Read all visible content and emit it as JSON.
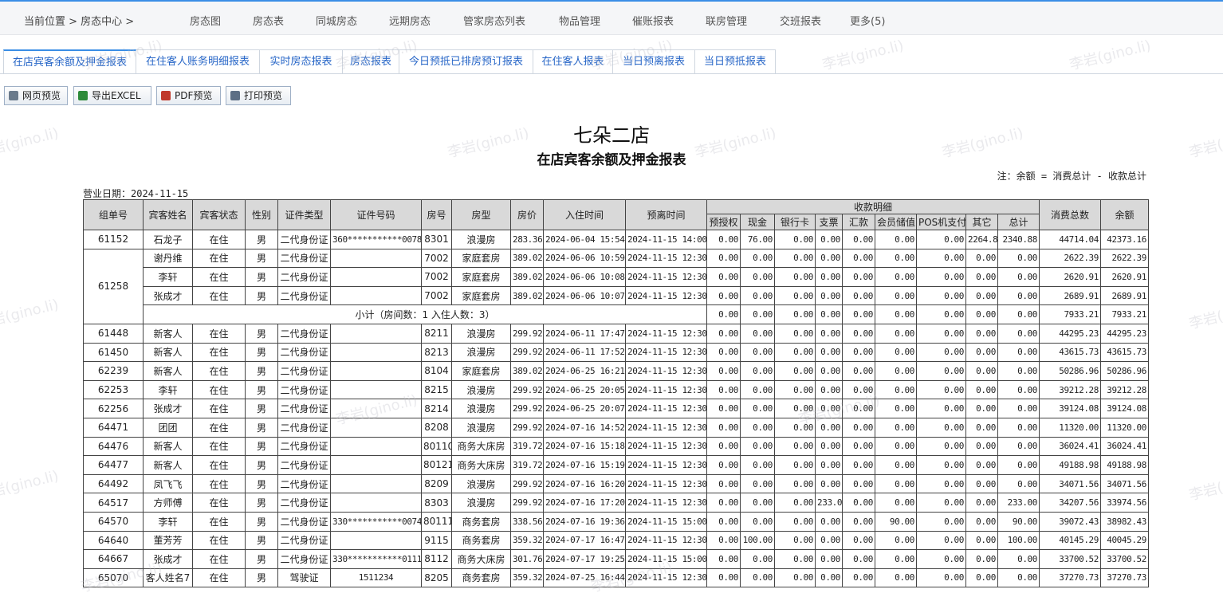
{
  "breadcrumb": {
    "label": "当前位置 > 房态中心 >"
  },
  "top_nav": [
    "房态图",
    "房态表",
    "同城房态",
    "远期房态",
    "管家房态列表",
    "物品管理",
    "催账报表",
    "联房管理",
    "交班报表",
    "更多(5)"
  ],
  "tabs": [
    "在店宾客余额及押金报表",
    "在住客人账务明细报表",
    "实时房态报表",
    "房态报表",
    "今日预抵已排房预订报表",
    "在住客人报表",
    "当日预离报表",
    "当日预抵报表"
  ],
  "active_tab": 0,
  "toolbar": {
    "web_preview": "网页预览",
    "export_excel": "导出EXCEL",
    "pdf_preview": "PDF预览",
    "print_preview": "打印预览"
  },
  "report": {
    "hotel": "七朵二店",
    "title": "在店宾客余额及押金报表",
    "note": "注：余额 = 消费总计 - 收款总计",
    "business_date": "营业日期：2024-11-15",
    "headers": {
      "group_no": "组单号",
      "guest": "宾客姓名",
      "status": "宾客状态",
      "gender": "性别",
      "id_type": "证件类型",
      "id_no": "证件号码",
      "room_no": "房号",
      "room_type": "房型",
      "price": "房价",
      "checkin": "入住时间",
      "checkout": "预离时间",
      "payment_detail": "收款明细",
      "consume_total": "消费总数",
      "balance": "余额",
      "payment_cols": [
        "预授权",
        "现金",
        "银行卡",
        "支票",
        "汇款",
        "会员储值",
        "POS机支付",
        "其它",
        "总计"
      ]
    },
    "rows": [
      {
        "group": "61152",
        "name": "石龙子",
        "status": "在住",
        "gender": "男",
        "idtype": "二代身份证",
        "idno": "360***********0078",
        "room": "8301",
        "rtype": "浪漫房",
        "price": "283.36",
        "in": "2024-06-04 15:54",
        "out": "2024-11-15 14:00",
        "p": [
          "0.00",
          "76.00",
          "0.00",
          "0.00",
          "0.00",
          "0.00",
          "0.00",
          "2264.8",
          "2340.88"
        ],
        "consume": "44714.04",
        "balance": "42373.16"
      },
      {
        "group": "61258",
        "name": "谢丹维",
        "status": "在住",
        "gender": "男",
        "idtype": "二代身份证",
        "idno": "",
        "room": "7002",
        "rtype": "家庭套房",
        "price": "389.02",
        "in": "2024-06-06 10:59",
        "out": "2024-11-15 12:30",
        "p": [
          "0.00",
          "0.00",
          "0.00",
          "0.00",
          "0.00",
          "0.00",
          "0.00",
          "0.00",
          "0.00"
        ],
        "consume": "2622.39",
        "balance": "2622.39"
      },
      {
        "group": "",
        "name": "李轩",
        "status": "在住",
        "gender": "男",
        "idtype": "二代身份证",
        "idno": "",
        "room": "7002",
        "rtype": "家庭套房",
        "price": "389.02",
        "in": "2024-06-06 10:08",
        "out": "2024-11-15 12:30",
        "p": [
          "0.00",
          "0.00",
          "0.00",
          "0.00",
          "0.00",
          "0.00",
          "0.00",
          "0.00",
          "0.00"
        ],
        "consume": "2620.91",
        "balance": "2620.91"
      },
      {
        "group": "",
        "name": "张成才",
        "status": "在住",
        "gender": "男",
        "idtype": "二代身份证",
        "idno": "",
        "room": "7002",
        "rtype": "家庭套房",
        "price": "389.02",
        "in": "2024-06-06 10:07",
        "out": "2024-11-15 12:30",
        "p": [
          "0.00",
          "0.00",
          "0.00",
          "0.00",
          "0.00",
          "0.00",
          "0.00",
          "0.00",
          "0.00"
        ],
        "consume": "2689.91",
        "balance": "2689.91"
      },
      {
        "subtotal": true,
        "label": "小计（房间数：1   入住人数：3）",
        "p": [
          "0.00",
          "0.00",
          "0.00",
          "0.00",
          "0.00",
          "0.00",
          "0.00",
          "0.00",
          "0.00"
        ],
        "consume": "7933.21",
        "balance": "7933.21"
      },
      {
        "group": "61448",
        "name": "新客人",
        "status": "在住",
        "gender": "男",
        "idtype": "二代身份证",
        "idno": "",
        "room": "8211",
        "rtype": "浪漫房",
        "price": "299.92",
        "in": "2024-06-11 17:47",
        "out": "2024-11-15 12:30",
        "p": [
          "0.00",
          "0.00",
          "0.00",
          "0.00",
          "0.00",
          "0.00",
          "0.00",
          "0.00",
          "0.00"
        ],
        "consume": "44295.23",
        "balance": "44295.23"
      },
      {
        "group": "61450",
        "name": "新客人",
        "status": "在住",
        "gender": "男",
        "idtype": "二代身份证",
        "idno": "",
        "room": "8213",
        "rtype": "浪漫房",
        "price": "299.92",
        "in": "2024-06-11 17:52",
        "out": "2024-11-15 12:30",
        "p": [
          "0.00",
          "0.00",
          "0.00",
          "0.00",
          "0.00",
          "0.00",
          "0.00",
          "0.00",
          "0.00"
        ],
        "consume": "43615.73",
        "balance": "43615.73"
      },
      {
        "group": "62239",
        "name": "新客人",
        "status": "在住",
        "gender": "男",
        "idtype": "二代身份证",
        "idno": "",
        "room": "8104",
        "rtype": "家庭套房",
        "price": "389.02",
        "in": "2024-06-25 16:21",
        "out": "2024-11-15 12:30",
        "p": [
          "0.00",
          "0.00",
          "0.00",
          "0.00",
          "0.00",
          "0.00",
          "0.00",
          "0.00",
          "0.00"
        ],
        "consume": "50286.96",
        "balance": "50286.96"
      },
      {
        "group": "62253",
        "name": "李轩",
        "status": "在住",
        "gender": "男",
        "idtype": "二代身份证",
        "idno": "",
        "room": "8215",
        "rtype": "浪漫房",
        "price": "299.92",
        "in": "2024-06-25 20:05",
        "out": "2024-11-15 12:30",
        "p": [
          "0.00",
          "0.00",
          "0.00",
          "0.00",
          "0.00",
          "0.00",
          "0.00",
          "0.00",
          "0.00"
        ],
        "consume": "39212.28",
        "balance": "39212.28"
      },
      {
        "group": "62256",
        "name": "张成才",
        "status": "在住",
        "gender": "男",
        "idtype": "二代身份证",
        "idno": "",
        "room": "8214",
        "rtype": "浪漫房",
        "price": "299.92",
        "in": "2024-06-25 20:07",
        "out": "2024-11-15 12:30",
        "p": [
          "0.00",
          "0.00",
          "0.00",
          "0.00",
          "0.00",
          "0.00",
          "0.00",
          "0.00",
          "0.00"
        ],
        "consume": "39124.08",
        "balance": "39124.08"
      },
      {
        "group": "64471",
        "name": "团团",
        "status": "在住",
        "gender": "男",
        "idtype": "二代身份证",
        "idno": "",
        "room": "8208",
        "rtype": "浪漫房",
        "price": "299.92",
        "in": "2024-07-16 14:52",
        "out": "2024-11-15 12:30",
        "p": [
          "0.00",
          "0.00",
          "0.00",
          "0.00",
          "0.00",
          "0.00",
          "0.00",
          "0.00",
          "0.00"
        ],
        "consume": "11320.00",
        "balance": "11320.00"
      },
      {
        "group": "64476",
        "name": "新客人",
        "status": "在住",
        "gender": "男",
        "idtype": "二代身份证",
        "idno": "",
        "room": "80110",
        "rtype": "商务大床房",
        "price": "319.72",
        "in": "2024-07-16 15:18",
        "out": "2024-11-15 12:30",
        "p": [
          "0.00",
          "0.00",
          "0.00",
          "0.00",
          "0.00",
          "0.00",
          "0.00",
          "0.00",
          "0.00"
        ],
        "consume": "36024.41",
        "balance": "36024.41"
      },
      {
        "group": "64477",
        "name": "新客人",
        "status": "在住",
        "gender": "男",
        "idtype": "二代身份证",
        "idno": "",
        "room": "80121",
        "rtype": "商务大床房",
        "price": "319.72",
        "in": "2024-07-16 15:19",
        "out": "2024-11-15 12:30",
        "p": [
          "0.00",
          "0.00",
          "0.00",
          "0.00",
          "0.00",
          "0.00",
          "0.00",
          "0.00",
          "0.00"
        ],
        "consume": "49188.98",
        "balance": "49188.98"
      },
      {
        "group": "64492",
        "name": "凤飞飞",
        "status": "在住",
        "gender": "男",
        "idtype": "二代身份证",
        "idno": "",
        "room": "8209",
        "rtype": "浪漫房",
        "price": "299.92",
        "in": "2024-07-16 16:20",
        "out": "2024-11-15 12:30",
        "p": [
          "0.00",
          "0.00",
          "0.00",
          "0.00",
          "0.00",
          "0.00",
          "0.00",
          "0.00",
          "0.00"
        ],
        "consume": "34071.56",
        "balance": "34071.56"
      },
      {
        "group": "64517",
        "name": "方师傅",
        "status": "在住",
        "gender": "男",
        "idtype": "二代身份证",
        "idno": "",
        "room": "8303",
        "rtype": "浪漫房",
        "price": "299.92",
        "in": "2024-07-16 17:20",
        "out": "2024-11-15 12:30",
        "p": [
          "0.00",
          "0.00",
          "0.00",
          "233.0",
          "0.00",
          "0.00",
          "0.00",
          "0.00",
          "233.00"
        ],
        "consume": "34207.56",
        "balance": "33974.56"
      },
      {
        "group": "64570",
        "name": "李轩",
        "status": "在住",
        "gender": "男",
        "idtype": "二代身份证",
        "idno": "330***********0074",
        "room": "80111",
        "rtype": "商务套房",
        "price": "338.56",
        "in": "2024-07-16 19:36",
        "out": "2024-11-15 15:00",
        "p": [
          "0.00",
          "0.00",
          "0.00",
          "0.00",
          "0.00",
          "90.00",
          "0.00",
          "0.00",
          "90.00"
        ],
        "consume": "39072.43",
        "balance": "38982.43"
      },
      {
        "group": "64640",
        "name": "董芳芳",
        "status": "在住",
        "gender": "男",
        "idtype": "二代身份证",
        "idno": "",
        "room": "9115",
        "rtype": "商务套房",
        "price": "359.32",
        "in": "2024-07-17 16:47",
        "out": "2024-11-15 12:30",
        "p": [
          "0.00",
          "100.00",
          "0.00",
          "0.00",
          "0.00",
          "0.00",
          "0.00",
          "0.00",
          "100.00"
        ],
        "consume": "40145.29",
        "balance": "40045.29"
      },
      {
        "group": "64667",
        "name": "张成才",
        "status": "在住",
        "gender": "男",
        "idtype": "二代身份证",
        "idno": "330***********0111",
        "room": "8112",
        "rtype": "商务大床房",
        "price": "301.76",
        "in": "2024-07-17 19:25",
        "out": "2024-11-15 15:00",
        "p": [
          "0.00",
          "0.00",
          "0.00",
          "0.00",
          "0.00",
          "0.00",
          "0.00",
          "0.00",
          "0.00"
        ],
        "consume": "33700.52",
        "balance": "33700.52"
      },
      {
        "group": "65070",
        "name": "客人姓名7",
        "status": "在住",
        "gender": "男",
        "idtype": "驾驶证",
        "idno": "1511234",
        "room": "8205",
        "rtype": "商务套房",
        "price": "359.32",
        "in": "2024-07-25 16:44",
        "out": "2024-11-15 12:30",
        "p": [
          "0.00",
          "0.00",
          "0.00",
          "0.00",
          "0.00",
          "0.00",
          "0.00",
          "0.00",
          "0.00"
        ],
        "consume": "37270.73",
        "balance": "37270.73"
      }
    ]
  },
  "watermark": "李岩(gino.li)"
}
